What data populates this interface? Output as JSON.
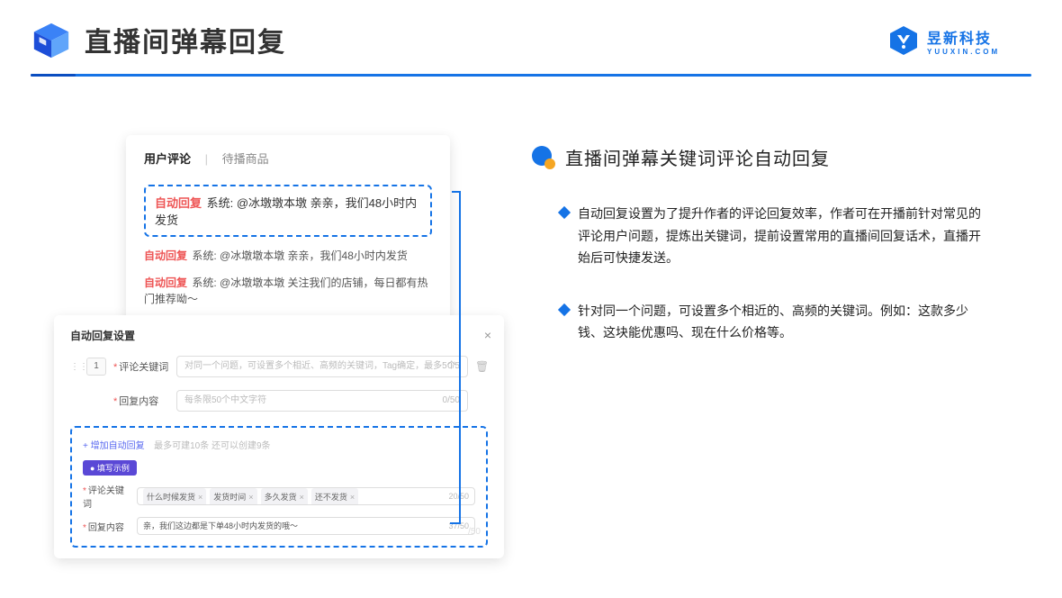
{
  "header": {
    "title": "直播间弹幕回复",
    "brand_main": "昱新科技",
    "brand_sub": "YUUXIN.COM"
  },
  "comments_panel": {
    "tab_active": "用户评论",
    "tab_inactive": "待播商品",
    "auto_reply_tag": "自动回复",
    "highlighted": "系统: @冰墩墩本墩 亲亲，我们48小时内发货",
    "line2": "系统: @冰墩墩本墩 亲亲，我们48小时内发货",
    "line3": "系统: @冰墩墩本墩 关注我们的店铺，每日都有热门推荐呦～"
  },
  "settings_panel": {
    "title": "自动回复设置",
    "index": "1",
    "keyword_label": "评论关键词",
    "keyword_placeholder": "对同一个问题，可设置多个相近、高频的关键词，Tag确定，最多5个",
    "keyword_counter": "0/5",
    "content_label": "回复内容",
    "content_placeholder": "每条限50个中文字符",
    "content_counter": "0/50",
    "add_link": "+ 增加自动回复",
    "add_hint": "最多可建10条 还可以创建9条",
    "example_pill": "● 填写示例",
    "ex_keyword_label": "评论关键词",
    "ex_chips": [
      "什么时候发货",
      "发货时间",
      "多久发货",
      "还不发货"
    ],
    "ex_keyword_counter": "20/50",
    "ex_content_label": "回复内容",
    "ex_content_value": "亲，我们这边都是下单48小时内发货的哦～",
    "ex_content_counter": "37/50",
    "ghost_counter": "/50"
  },
  "right": {
    "section_title": "直播间弹幕关键词评论自动回复",
    "bullets": [
      "自动回复设置为了提升作者的评论回复效率，作者可在开播前针对常见的评论用户问题，提炼出关键词，提前设置常用的直播间回复话术，直播开始后可快捷发送。",
      "针对同一个问题，可设置多个相近的、高频的关键词。例如：这款多少钱、这块能优惠吗、现在什么价格等。"
    ]
  }
}
